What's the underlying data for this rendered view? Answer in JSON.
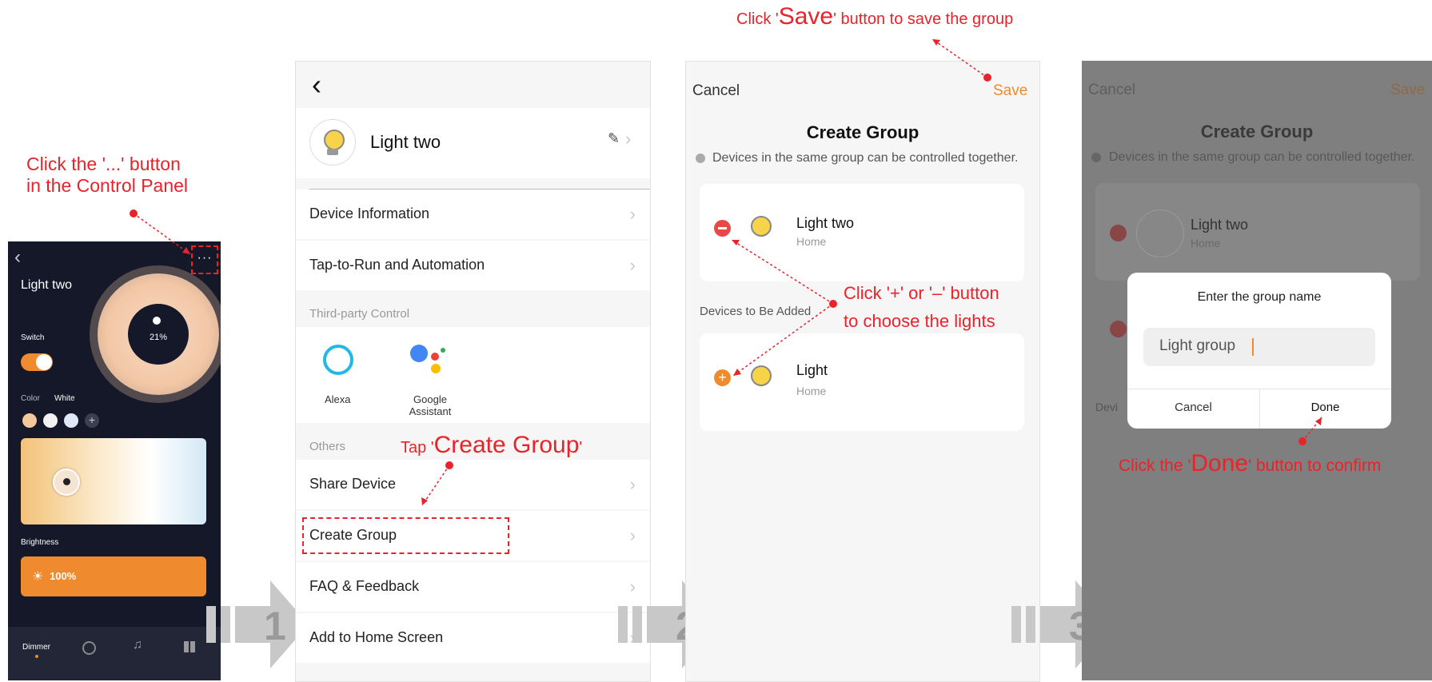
{
  "annotations": {
    "step0_line1": "Click the '...' button",
    "step0_line2": "in the Control Panel",
    "save_pre": "Click '",
    "save_big": "Save",
    "save_post": "' button to save the group",
    "create_pre": "Tap '",
    "create_big": "Create Group",
    "create_post": "'",
    "plusminus_line1": "Click '+' or '–' button",
    "plusminus_line2": "to choose the lights",
    "done_pre": "Click the '",
    "done_big": "Done",
    "done_post": "' button to confirm"
  },
  "control_panel": {
    "back": "‹",
    "more": "···",
    "device_name": "Light two",
    "percent": "21%",
    "switch_label": "Switch",
    "color_tab": "Color",
    "white_tab": "White",
    "add": "+",
    "brightness_label": "Brightness",
    "brightness_value": "100%",
    "nav_dimmer": "Dimmer"
  },
  "settings": {
    "back": "‹",
    "device_name": "Light two",
    "items_top": [
      "Device Information",
      "Tap-to-Run and Automation"
    ],
    "third_party_header": "Third-party Control",
    "alexa": "Alexa",
    "google_line1": "Google",
    "google_line2": "Assistant",
    "others_header": "Others",
    "items_bottom": [
      "Share Device",
      "Create Group",
      "FAQ & Feedback",
      "Add to Home Screen"
    ]
  },
  "create_group": {
    "cancel": "Cancel",
    "save": "Save",
    "title": "Create Group",
    "info": "Devices in the same group can be controlled together.",
    "added_device": {
      "name": "Light two",
      "room": "Home"
    },
    "to_add_header": "Devices to Be Added",
    "to_add_device": {
      "name": "Light",
      "room": "Home"
    }
  },
  "dialog_screen": {
    "cancel": "Cancel",
    "save": "Save",
    "title": "Create Group",
    "info": "Devices in the same group can be controlled together.",
    "device_name": "Light two",
    "device_room": "Home",
    "bg_label": "Devi",
    "dialog_title": "Enter the group name",
    "input_value": "Light group",
    "dialog_cancel": "Cancel",
    "dialog_done": "Done"
  },
  "steps": [
    "1",
    "2",
    "3"
  ],
  "colors": {
    "accent_orange": "#f08a2e",
    "annotation_red": "#e8232a",
    "dark_panel": "#141829"
  }
}
